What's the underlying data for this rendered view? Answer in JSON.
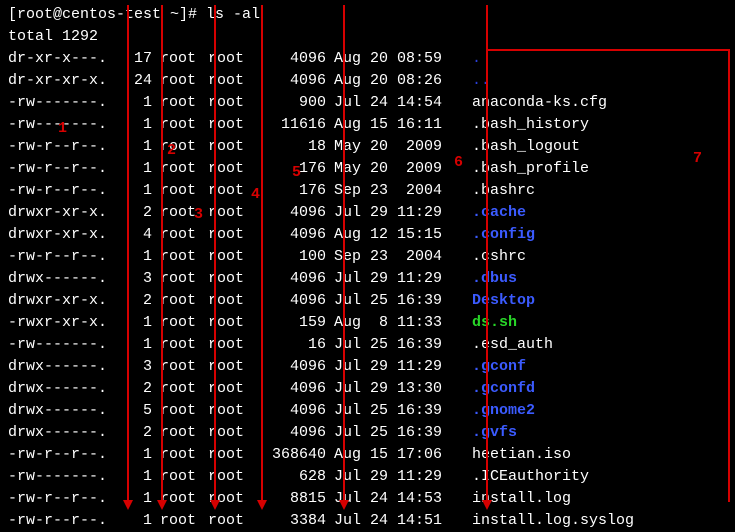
{
  "prompt": "[root@centos-test ~]# ",
  "command": "ls -al",
  "total": "total 1292",
  "rows": [
    {
      "perms": "dr-xr-x---.",
      "links": "17",
      "owner": "root",
      "group": "root",
      "size": "4096",
      "date": "Aug 20 08:59",
      "name": ".",
      "cls": "c-dblue"
    },
    {
      "perms": "dr-xr-xr-x.",
      "links": "24",
      "owner": "root",
      "group": "root",
      "size": "4096",
      "date": "Aug 20 08:26",
      "name": "..",
      "cls": "c-dblue"
    },
    {
      "perms": "-rw-------.",
      "links": "1",
      "owner": "root",
      "group": "root",
      "size": "900",
      "date": "Jul 24 14:54",
      "name": "anaconda-ks.cfg",
      "cls": "c-white"
    },
    {
      "perms": "-rw-------.",
      "links": "1",
      "owner": "root",
      "group": "root",
      "size": "11616",
      "date": "Aug 15 16:11",
      "name": ".bash_history",
      "cls": "c-white"
    },
    {
      "perms": "-rw-r--r--.",
      "links": "1",
      "owner": "root",
      "group": "root",
      "size": "18",
      "date": "May 20  2009",
      "name": ".bash_logout",
      "cls": "c-white"
    },
    {
      "perms": "-rw-r--r--.",
      "links": "1",
      "owner": "root",
      "group": "root",
      "size": "176",
      "date": "May 20  2009",
      "name": ".bash_profile",
      "cls": "c-white"
    },
    {
      "perms": "-rw-r--r--.",
      "links": "1",
      "owner": "root",
      "group": "root",
      "size": "176",
      "date": "Sep 23  2004",
      "name": ".bashrc",
      "cls": "c-white"
    },
    {
      "perms": "drwxr-xr-x.",
      "links": "2",
      "owner": "root",
      "group": "root",
      "size": "4096",
      "date": "Jul 29 11:29",
      "name": ".cache",
      "cls": "c-blue"
    },
    {
      "perms": "drwxr-xr-x.",
      "links": "4",
      "owner": "root",
      "group": "root",
      "size": "4096",
      "date": "Aug 12 15:15",
      "name": ".config",
      "cls": "c-blue"
    },
    {
      "perms": "-rw-r--r--.",
      "links": "1",
      "owner": "root",
      "group": "root",
      "size": "100",
      "date": "Sep 23  2004",
      "name": ".cshrc",
      "cls": "c-white"
    },
    {
      "perms": "drwx------.",
      "links": "3",
      "owner": "root",
      "group": "root",
      "size": "4096",
      "date": "Jul 29 11:29",
      "name": ".dbus",
      "cls": "c-blue"
    },
    {
      "perms": "drwxr-xr-x.",
      "links": "2",
      "owner": "root",
      "group": "root",
      "size": "4096",
      "date": "Jul 25 16:39",
      "name": "Desktop",
      "cls": "c-blue"
    },
    {
      "perms": "-rwxr-xr-x.",
      "links": "1",
      "owner": "root",
      "group": "root",
      "size": "159",
      "date": "Aug  8 11:33",
      "name": "ds.sh",
      "cls": "c-green"
    },
    {
      "perms": "-rw-------.",
      "links": "1",
      "owner": "root",
      "group": "root",
      "size": "16",
      "date": "Jul 25 16:39",
      "name": ".esd_auth",
      "cls": "c-white"
    },
    {
      "perms": "drwx------.",
      "links": "3",
      "owner": "root",
      "group": "root",
      "size": "4096",
      "date": "Jul 29 11:29",
      "name": ".gconf",
      "cls": "c-blue"
    },
    {
      "perms": "drwx------.",
      "links": "2",
      "owner": "root",
      "group": "root",
      "size": "4096",
      "date": "Jul 29 13:30",
      "name": ".gconfd",
      "cls": "c-blue"
    },
    {
      "perms": "drwx------.",
      "links": "5",
      "owner": "root",
      "group": "root",
      "size": "4096",
      "date": "Jul 25 16:39",
      "name": ".gnome2",
      "cls": "c-blue"
    },
    {
      "perms": "drwx------.",
      "links": "2",
      "owner": "root",
      "group": "root",
      "size": "4096",
      "date": "Jul 25 16:39",
      "name": ".gvfs",
      "cls": "c-blue"
    },
    {
      "perms": "-rw-r--r--.",
      "links": "1",
      "owner": "root",
      "group": "root",
      "size": "368640",
      "date": "Aug 15 17:06",
      "name": "heetian.iso",
      "cls": "c-white"
    },
    {
      "perms": "-rw-------.",
      "links": "1",
      "owner": "root",
      "group": "root",
      "size": "628",
      "date": "Jul 29 11:29",
      "name": ".ICEauthority",
      "cls": "c-white"
    },
    {
      "perms": "-rw-r--r--.",
      "links": "1",
      "owner": "root",
      "group": "root",
      "size": "8815",
      "date": "Jul 24 14:53",
      "name": "install.log",
      "cls": "c-white"
    },
    {
      "perms": "-rw-r--r--.",
      "links": "1",
      "owner": "root",
      "group": "root",
      "size": "3384",
      "date": "Jul 24 14:51",
      "name": "install.log.syslog",
      "cls": "c-white"
    }
  ],
  "markers": {
    "m1": "1",
    "m2": "2",
    "m3": "3",
    "m4": "4",
    "m5": "5",
    "m6": "6",
    "m7": "7"
  },
  "arrowsX": [
    127,
    161,
    214,
    261,
    343,
    486
  ],
  "arrowYStart": 5,
  "arrowYEnd": 510,
  "hbarTop": 49,
  "hbarRight": 730
}
